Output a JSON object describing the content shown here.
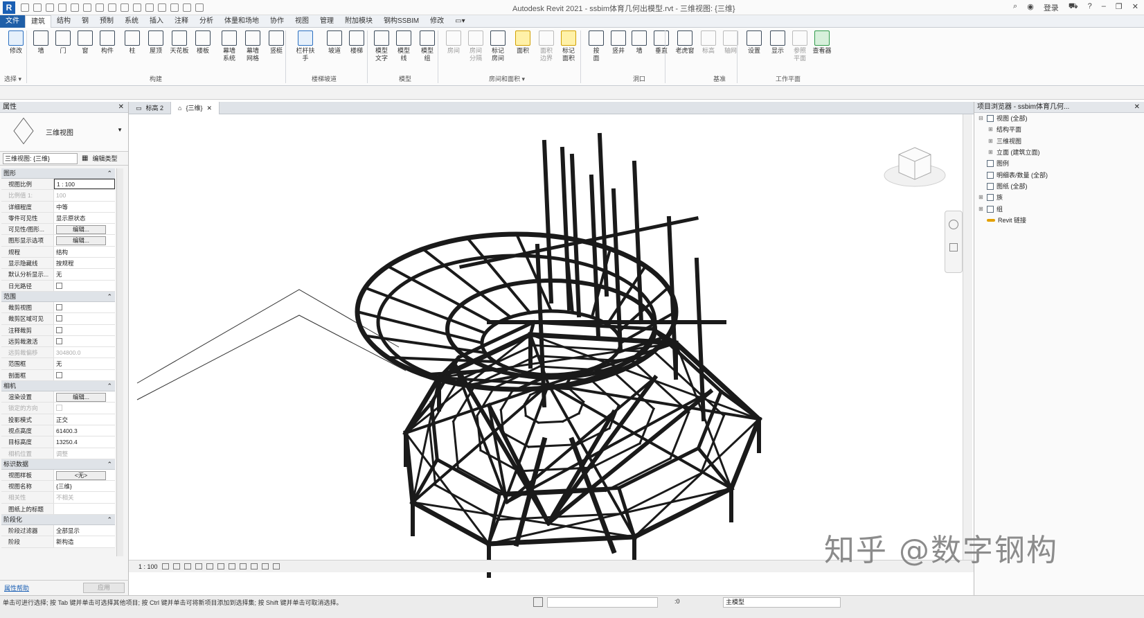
{
  "app": {
    "logo": "R",
    "title": "Autodesk Revit 2021 - ssbim体育几何出模型.rvt - 三维视图: {三维}",
    "login": "登录",
    "title_right_icons": [
      "search-icon",
      "user-icon",
      "cart-icon",
      "help-icon",
      "minimize-icon",
      "restore-icon",
      "close-icon"
    ]
  },
  "tabs": [
    "文件",
    "建筑",
    "结构",
    "钢",
    "预制",
    "系统",
    "插入",
    "注释",
    "分析",
    "体量和场地",
    "协作",
    "视图",
    "管理",
    "附加模块",
    "钢构SSBIM",
    "修改"
  ],
  "ribbon": {
    "buttons": [
      {
        "label": "修改",
        "style": "blue"
      },
      {
        "label": "墙",
        "style": ""
      },
      {
        "label": "门",
        "style": ""
      },
      {
        "label": "窗",
        "style": ""
      },
      {
        "label": "构件",
        "style": ""
      },
      {
        "label": "柱",
        "style": ""
      },
      {
        "label": "屋顶",
        "style": ""
      },
      {
        "label": "天花板",
        "style": ""
      },
      {
        "label": "楼板",
        "style": ""
      },
      {
        "label": "幕墙\n系统",
        "style": ""
      },
      {
        "label": "幕墙\n网格",
        "style": ""
      },
      {
        "label": "竖梃",
        "style": ""
      },
      {
        "label": "栏杆扶手",
        "style": "blue"
      },
      {
        "label": "坡道",
        "style": ""
      },
      {
        "label": "楼梯",
        "style": ""
      },
      {
        "label": "模型\n文字",
        "style": ""
      },
      {
        "label": "模型\n线",
        "style": ""
      },
      {
        "label": "模型\n组",
        "style": ""
      },
      {
        "label": "房间",
        "style": "dim"
      },
      {
        "label": "房间\n分隔",
        "style": "dim"
      },
      {
        "label": "标记\n房间",
        "style": ""
      },
      {
        "label": "面积",
        "style": "yellow"
      },
      {
        "label": "面积\n边界",
        "style": "dim"
      },
      {
        "label": "标记\n面积",
        "style": "yellow"
      },
      {
        "label": "按\n面",
        "style": ""
      },
      {
        "label": "竖井",
        "style": ""
      },
      {
        "label": "墙",
        "style": ""
      },
      {
        "label": "垂直",
        "style": ""
      },
      {
        "label": "老虎窗",
        "style": ""
      },
      {
        "label": "标高",
        "style": "dim"
      },
      {
        "label": "轴网",
        "style": "dim"
      },
      {
        "label": "设置",
        "style": ""
      },
      {
        "label": "显示",
        "style": ""
      },
      {
        "label": "参照\n平面",
        "style": "dim"
      },
      {
        "label": "查看器",
        "style": "green"
      }
    ],
    "groups": [
      "选择 ▾",
      "构建",
      "楼梯坡道",
      "模型",
      "房间和面积 ▾",
      "洞口",
      "基准",
      "工作平面"
    ]
  },
  "properties": {
    "title": "属性",
    "type_name": "三维视图",
    "selector_value": "三维视图: {三维}",
    "edit_type": "编辑类型",
    "sections": [
      {
        "name": "图形",
        "rows": [
          {
            "k": "视图比例",
            "v": "1 : 100",
            "kind": "input"
          },
          {
            "k": "比例值 1:",
            "v": "100",
            "kind": "dim"
          },
          {
            "k": "详细程度",
            "v": "中等",
            "kind": "text"
          },
          {
            "k": "零件可见性",
            "v": "显示原状态",
            "kind": "text"
          },
          {
            "k": "可见性/图形...",
            "v": "编辑...",
            "kind": "button"
          },
          {
            "k": "图形显示选项",
            "v": "编辑...",
            "kind": "button"
          },
          {
            "k": "规程",
            "v": "结构",
            "kind": "text"
          },
          {
            "k": "显示隐藏线",
            "v": "按规程",
            "kind": "text"
          },
          {
            "k": "默认分析显示...",
            "v": "无",
            "kind": "text"
          },
          {
            "k": "日光路径",
            "v": "",
            "kind": "check"
          }
        ]
      },
      {
        "name": "范围",
        "rows": [
          {
            "k": "裁剪视图",
            "v": "",
            "kind": "check"
          },
          {
            "k": "裁剪区域可见",
            "v": "",
            "kind": "check"
          },
          {
            "k": "注释裁剪",
            "v": "",
            "kind": "check"
          },
          {
            "k": "远剪裁激活",
            "v": "",
            "kind": "check"
          },
          {
            "k": "远剪裁偏移",
            "v": "304800.0",
            "kind": "dim"
          },
          {
            "k": "范围框",
            "v": "无",
            "kind": "text"
          },
          {
            "k": "剖面框",
            "v": "",
            "kind": "check"
          }
        ]
      },
      {
        "name": "相机",
        "rows": [
          {
            "k": "渲染设置",
            "v": "编辑...",
            "kind": "button"
          },
          {
            "k": "锁定的方向",
            "v": "",
            "kind": "dimcheck"
          },
          {
            "k": "投影模式",
            "v": "正交",
            "kind": "text"
          },
          {
            "k": "视点高度",
            "v": "61400.3",
            "kind": "text"
          },
          {
            "k": "目标高度",
            "v": "13250.4",
            "kind": "text"
          },
          {
            "k": "相机位置",
            "v": "调整",
            "kind": "dim"
          }
        ]
      },
      {
        "name": "标识数据",
        "rows": [
          {
            "k": "视图样板",
            "v": "<无>",
            "kind": "button"
          },
          {
            "k": "视图名称",
            "v": "{三维}",
            "kind": "text"
          },
          {
            "k": "相关性",
            "v": "不相关",
            "kind": "dim"
          },
          {
            "k": "图纸上的标题",
            "v": "",
            "kind": "text"
          }
        ]
      },
      {
        "name": "阶段化",
        "rows": [
          {
            "k": "阶段过滤器",
            "v": "全部显示",
            "kind": "text"
          },
          {
            "k": "阶段",
            "v": "新构造",
            "kind": "text"
          }
        ]
      }
    ],
    "help_link": "属性帮助",
    "apply": "应用"
  },
  "doc_tabs": [
    {
      "label": "标高 2",
      "active": false
    },
    {
      "label": "{三维}",
      "active": true
    }
  ],
  "view_bar": {
    "scale": "1 : 100"
  },
  "browser": {
    "title": "项目浏览器 - ssbim体育几何...",
    "items": [
      {
        "label": "视图 (全部)",
        "level": 0,
        "toggle": "⊟",
        "icon": "views-icon"
      },
      {
        "label": "结构平面",
        "level": 1,
        "toggle": "⊞",
        "icon": ""
      },
      {
        "label": "三维视图",
        "level": 1,
        "toggle": "⊞",
        "icon": ""
      },
      {
        "label": "立面 (建筑立面)",
        "level": 1,
        "toggle": "⊞",
        "icon": ""
      },
      {
        "label": "图例",
        "level": 0,
        "toggle": "",
        "icon": "legend-icon"
      },
      {
        "label": "明细表/数量 (全部)",
        "level": 0,
        "toggle": "",
        "icon": "schedule-icon"
      },
      {
        "label": "图纸 (全部)",
        "level": 0,
        "toggle": "",
        "icon": "sheet-icon"
      },
      {
        "label": "族",
        "level": 0,
        "toggle": "⊞",
        "icon": "family-icon"
      },
      {
        "label": "组",
        "level": 0,
        "toggle": "⊞",
        "icon": "group-icon"
      },
      {
        "label": "Revit 链接",
        "level": 0,
        "toggle": "",
        "icon": "link-icon"
      }
    ]
  },
  "status": {
    "text": "单击可进行选择; 按 Tab 键并单击可选择其他项目; 按 Ctrl 键并单击可将新项目添加到选择集; 按 Shift 键并单击可取消选择。",
    "zero": ":0",
    "model": "主模型"
  },
  "watermark": "知乎 @数字钢构"
}
